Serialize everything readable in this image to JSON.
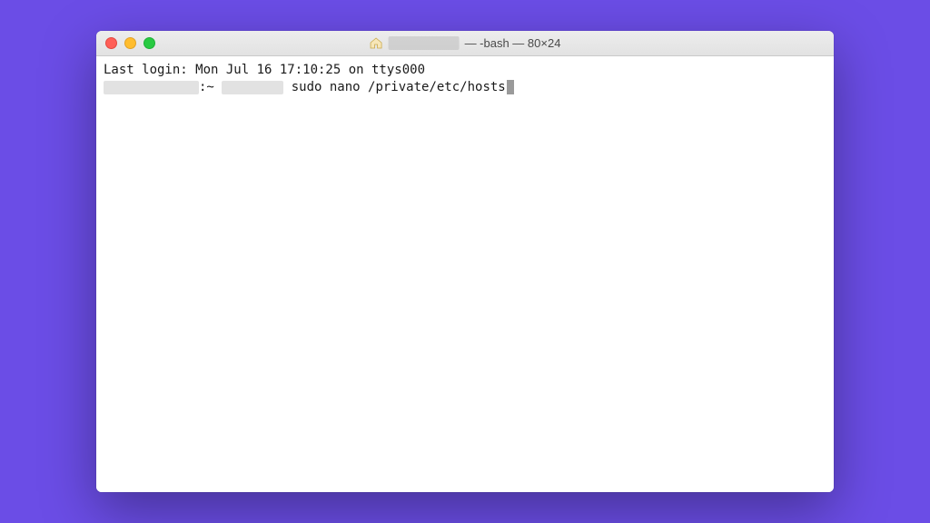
{
  "titlebar": {
    "title_suffix": " — -bash — 80×24"
  },
  "terminal": {
    "last_login": "Last login: Mon Jul 16 17:10:25 on ttys000",
    "prompt_separator": ":~ ",
    "command": " sudo nano /private/etc/hosts"
  }
}
